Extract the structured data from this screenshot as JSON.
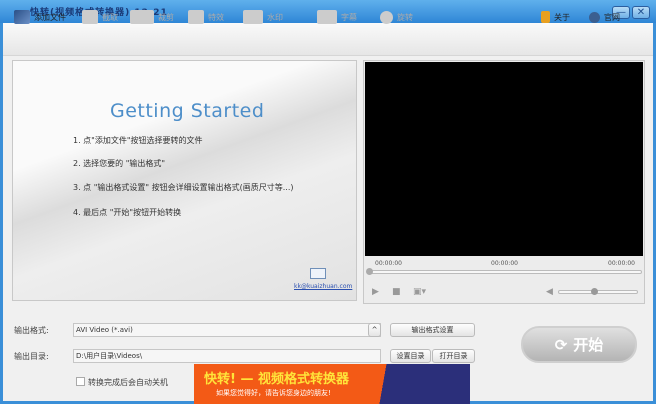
{
  "window": {
    "title": "快转(视频格式转换器)  12.21",
    "minimize": "—",
    "close": "✕"
  },
  "toolbar": {
    "items": [
      {
        "label": "添加文件",
        "icon": "add-file-icon",
        "enabled": true
      },
      {
        "label": "截取",
        "icon": "clip-icon",
        "enabled": false
      },
      {
        "label": "裁剪",
        "icon": "crop-icon",
        "enabled": false
      },
      {
        "label": "特效",
        "icon": "effects-icon",
        "enabled": false
      },
      {
        "label": "水印",
        "icon": "watermark-icon",
        "enabled": false
      },
      {
        "label": "字幕",
        "icon": "subtitle-icon",
        "enabled": false
      },
      {
        "label": "旋转",
        "icon": "rotate-icon",
        "enabled": false
      }
    ],
    "about": "关于",
    "website": "官网"
  },
  "guide": {
    "title": "Getting Started",
    "steps": [
      "1. 点\"添加文件\"按钮选择要转的文件",
      "2. 选择您要的 \"输出格式\"",
      "3. 点 \"输出格式设置\" 按钮会详细设置输出格式(画质尺寸等...)",
      "4. 最后点 \"开始\"按钮开始转换"
    ],
    "email_link": "kk@kuaizhuan.com"
  },
  "player": {
    "time_start": "00:00:00",
    "time_mid": "00:00:00",
    "time_end": "00:00:00",
    "seek_progress": 0,
    "volume": 0.45
  },
  "output": {
    "format_label": "输出格式:",
    "format_value": "AVI Video (*.avi)",
    "format_settings": "输出格式设置",
    "dir_label": "输出目录:",
    "dir_value": "D:\\用户目录\\Videos\\",
    "set_dir": "设置目录",
    "open_dir": "打开目录",
    "shutdown_label": "转换完成后会自动关机",
    "shutdown_checked": false
  },
  "start_button": "开始",
  "ad": {
    "title": "快转! — 视频格式转换器",
    "subtitle": "如果您觉得好，请告诉您身边的朋友!"
  }
}
